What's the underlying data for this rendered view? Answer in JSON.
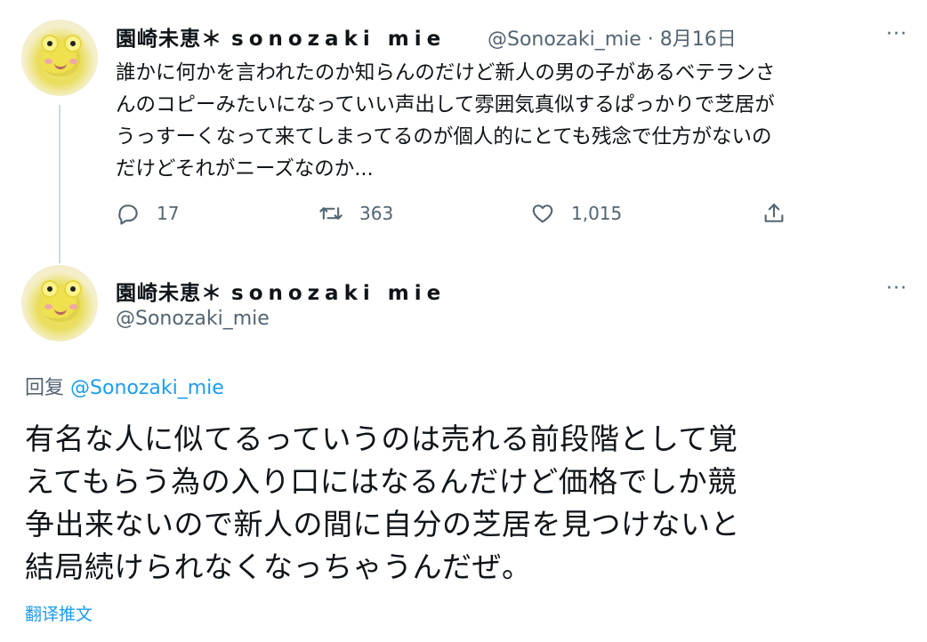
{
  "tweet1": {
    "display_name": "園崎未恵＊",
    "display_name_latin": "sonozaki mie",
    "handle": "@Sonozaki_mie",
    "separator": "·",
    "date": "8月16日",
    "more": "···",
    "body_lines": [
      "誰かに何かを言われたのか知らんのだけど新人の男の子があるベテランさ",
      "んのコピーみたいになっていい声出して雰囲気真似するぱっかりで芝居が",
      "うっすーくなって来てしまってるのが個人的にとても残念で仕方がないの",
      "だけどそれがニーズなのか..."
    ],
    "actions": {
      "replies": "17",
      "retweets": "363",
      "likes": "1,015"
    }
  },
  "tweet2": {
    "display_name": "園崎未恵＊",
    "display_name_latin": "sonozaki mie",
    "handle": "@Sonozaki_mie",
    "more": "···",
    "reply_prefix": "回复",
    "reply_mention": "@Sonozaki_mie",
    "body_lines": [
      "有名な人に似てるっていうのは売れる前段階として覚",
      "えてもらう為の入り口にはなるんだけど価格でしか競",
      "争出来ないので新人の間に自分の芝居を見つけないと",
      "結局続けられなくなっちゃうんだぜ。"
    ],
    "translate_label": "翻译推文"
  },
  "colors": {
    "text": "#0f1419",
    "secondary": "#536471",
    "accent": "#1d9bf0",
    "thread_line": "#cfd9de"
  },
  "icons": [
    "reply-icon",
    "retweet-icon",
    "like-icon",
    "share-icon",
    "more-icon"
  ]
}
